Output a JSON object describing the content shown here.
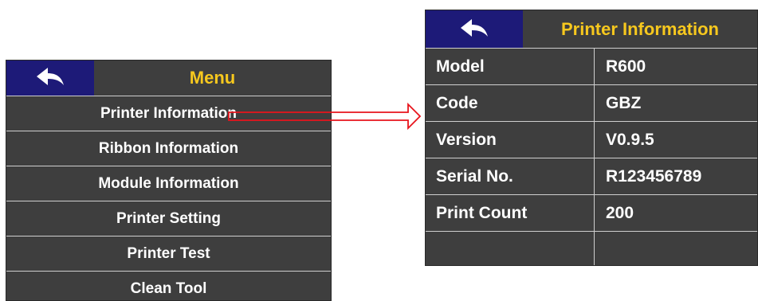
{
  "menu": {
    "title": "Menu",
    "back_icon": "back-arrow-icon",
    "items": [
      {
        "label": "Printer Information"
      },
      {
        "label": "Ribbon Information"
      },
      {
        "label": "Module Information"
      },
      {
        "label": "Printer Setting"
      },
      {
        "label": "Printer Test"
      },
      {
        "label": "Clean Tool"
      }
    ]
  },
  "printer_info": {
    "title": "Printer Information",
    "back_icon": "back-arrow-icon",
    "rows": [
      {
        "label": "Model",
        "value": "R600"
      },
      {
        "label": "Code",
        "value": "GBZ"
      },
      {
        "label": "Version",
        "value": "V0.9.5"
      },
      {
        "label": "Serial No.",
        "value": "R123456789"
      },
      {
        "label": "Print Count",
        "value": "200"
      },
      {
        "label": "",
        "value": ""
      }
    ]
  },
  "colors": {
    "screen_bg": "#3e3e3e",
    "header_back_bg": "#1d1a78",
    "title_color": "#f7c81e",
    "text_color": "#ffffff",
    "arrow_color": "#e8141c"
  }
}
